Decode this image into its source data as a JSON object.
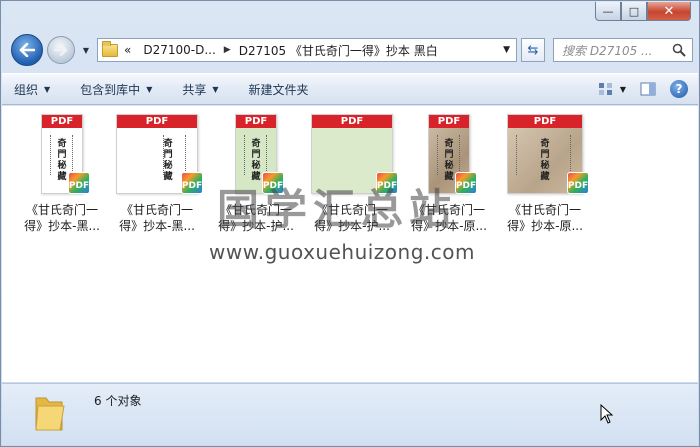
{
  "window": {
    "caption": {
      "minimize": "—",
      "maximize": "□",
      "close": "✕"
    }
  },
  "nav": {
    "address_segments": [
      "D27100-D...",
      "D27105 《甘氏奇门一得》抄本 黑白"
    ],
    "address_prefix": "«",
    "search_placeholder": "搜索 D27105 ..."
  },
  "toolbar": {
    "organize": "组织",
    "include_in_library": "包含到库中",
    "share": "共享",
    "new_folder": "新建文件夹"
  },
  "files": [
    {
      "name": "《甘氏奇门一\n得》抄本-黑...",
      "title": "奇門秘藏",
      "style": "white",
      "badge": "PDF",
      "band": "PDF"
    },
    {
      "name": "《甘氏奇门一\n得》抄本-黑...",
      "title": "奇門秘藏",
      "style": "white-wide",
      "badge": "PDF",
      "band": "PDF"
    },
    {
      "name": "《甘氏奇门一\n得》抄本-护...",
      "title": "奇門秘藏",
      "style": "green",
      "badge": "PDF",
      "band": "PDF"
    },
    {
      "name": "《甘氏奇门一\n得》抄本-护...",
      "title": "",
      "style": "green-wide",
      "badge": "PDF",
      "band": "PDF"
    },
    {
      "name": "《甘氏奇门一\n得》抄本-原...",
      "title": "奇門秘藏",
      "style": "sepia",
      "badge": "PDF",
      "band": "PDF"
    },
    {
      "name": "《甘氏奇门一\n得》抄本-原...",
      "title": "奇門秘藏",
      "style": "sepia-wide",
      "badge": "PDF",
      "band": "PDF"
    }
  ],
  "watermark": {
    "text_cn": "国学汇总站",
    "url": "www.guoxuehuizong.com"
  },
  "status": {
    "count_text": "6 个对象"
  },
  "colors": {
    "pdf_red": "#d8232a",
    "window_blue": "#cfdcec"
  }
}
